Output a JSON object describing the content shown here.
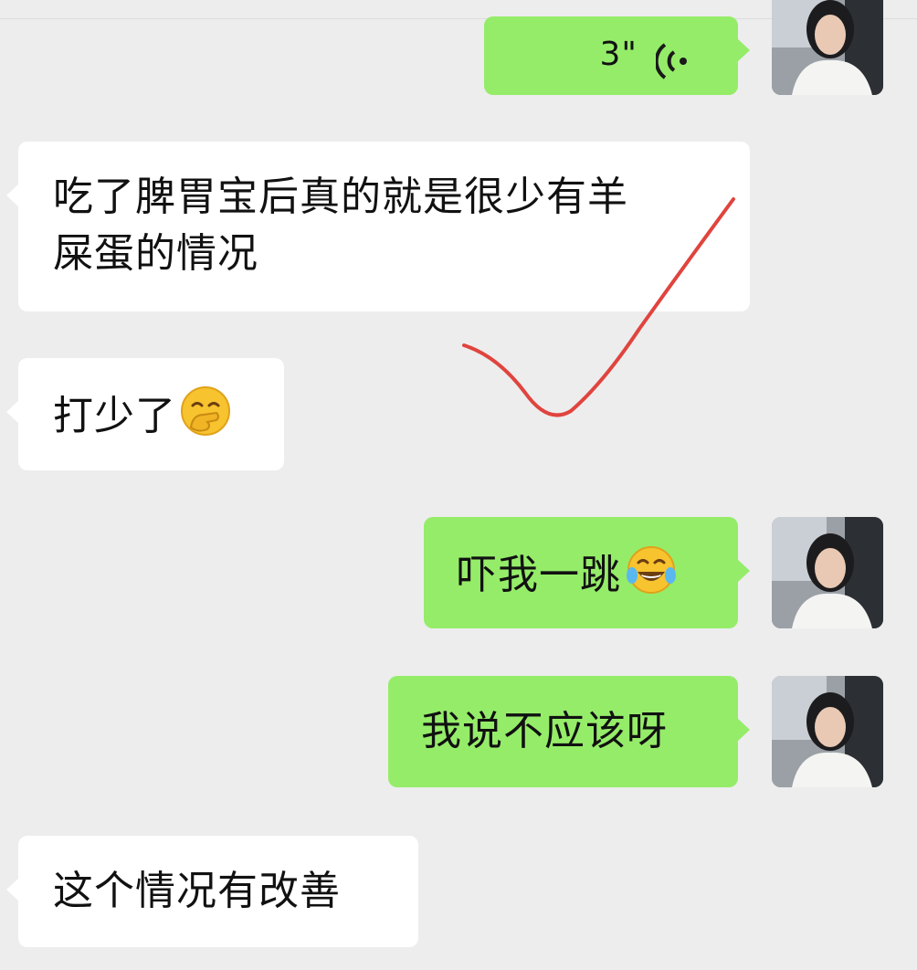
{
  "messages": [
    {
      "id": "m0",
      "side": "out",
      "type": "voice",
      "duration": "3\""
    },
    {
      "id": "m1",
      "side": "in",
      "text_line1": "吃了脾胃宝后真的就是很少有羊",
      "text_line2": "屎蛋的情况"
    },
    {
      "id": "m2",
      "side": "in",
      "text": "打少了",
      "emoji": "hand-over-mouth-emoji"
    },
    {
      "id": "m3",
      "side": "out",
      "text": "吓我一跳",
      "emoji": "tears-of-joy-emoji"
    },
    {
      "id": "m4",
      "side": "out",
      "text": "我说不应该呀"
    },
    {
      "id": "m5",
      "side": "in",
      "text": "这个情况有改善"
    }
  ],
  "colors": {
    "background": "#ededed",
    "incoming_bubble": "#ffffff",
    "outgoing_bubble": "#95ec69",
    "annotation_check": "#e0443e"
  },
  "annotation": {
    "icon": "red-checkmark-annotation"
  }
}
